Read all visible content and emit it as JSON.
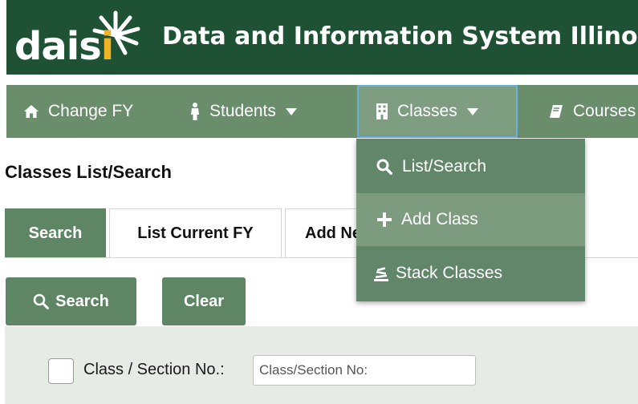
{
  "header": {
    "logo_text": "dais",
    "logo_i": "i",
    "title": "Data and Information System Illinois"
  },
  "navbar": {
    "items": [
      {
        "label": "Change FY",
        "icon": "home-icon"
      },
      {
        "label": "Students",
        "icon": "person-icon"
      },
      {
        "label": "Classes",
        "icon": "building-icon"
      },
      {
        "label": "Courses",
        "icon": "book-icon"
      }
    ]
  },
  "dropdown": {
    "items": [
      {
        "label": "List/Search",
        "icon": "search-icon"
      },
      {
        "label": "Add Class",
        "icon": "plus-icon"
      },
      {
        "label": "Stack Classes",
        "icon": "stack-icon"
      }
    ]
  },
  "page": {
    "title": "Classes List/Search"
  },
  "tabs": [
    {
      "label": "Search"
    },
    {
      "label": "List Current FY"
    },
    {
      "label": "Add New"
    }
  ],
  "actions": {
    "search_label": "Search",
    "clear_label": "Clear"
  },
  "filter": {
    "class_section_label": "Class / Section No.:",
    "class_section_placeholder": "Class/Section No:"
  },
  "colors": {
    "header_bg": "#1f5234",
    "nav_bg": "#6a8d6c",
    "accent_green": "#5e8564",
    "logo_accent": "#f0b323",
    "focus_border": "#6cb0e0"
  }
}
